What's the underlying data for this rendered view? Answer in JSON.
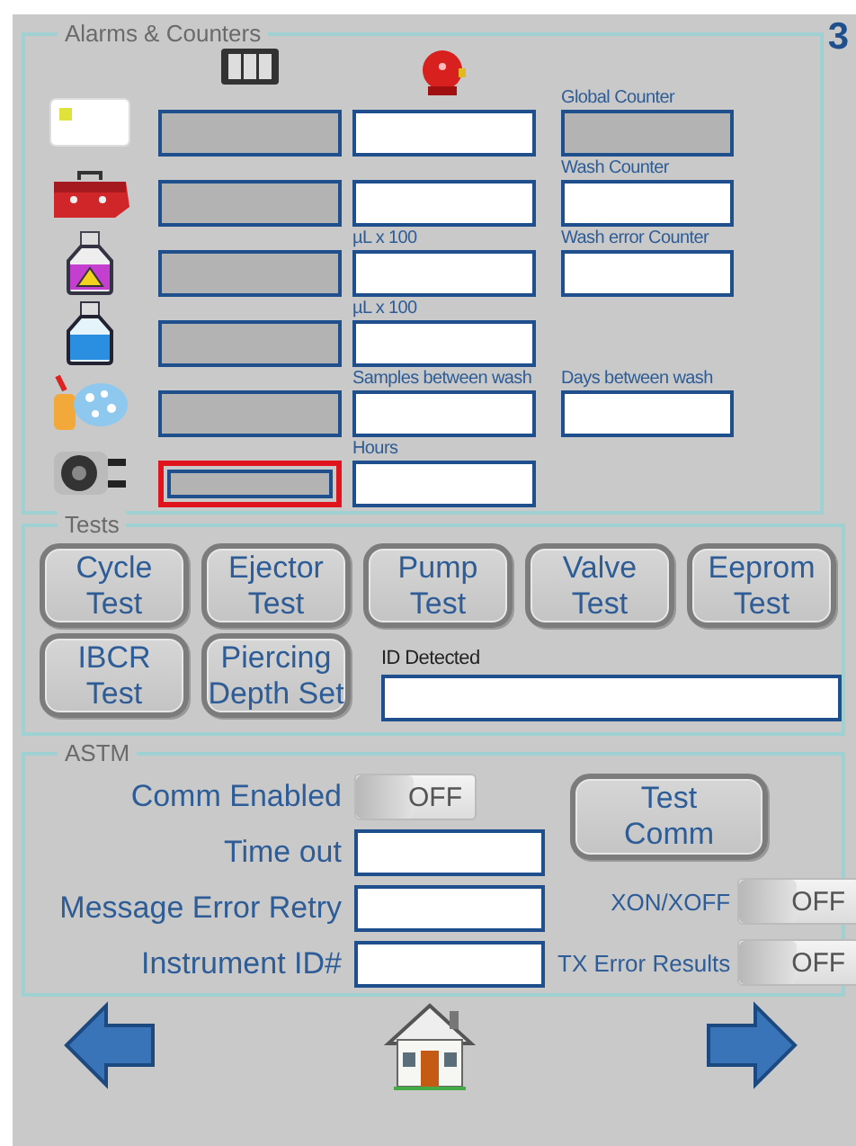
{
  "page_number": "3",
  "alarms": {
    "title": "Alarms & Counters",
    "rows": [
      {
        "kind": "label-card",
        "counter": {
          "disabled": true,
          "selected": false
        },
        "alarm": {
          "disabled": false
        },
        "extra": {
          "label": "Global Counter",
          "disabled": true
        }
      },
      {
        "kind": "toolbox",
        "counter": {
          "disabled": true,
          "selected": false
        },
        "alarm": {
          "disabled": false
        },
        "extra": {
          "label": "Wash Counter",
          "disabled": false
        }
      },
      {
        "kind": "hazard-bottle",
        "counter": {
          "disabled": true,
          "selected": false
        },
        "alarm": {
          "label": "µL x 100",
          "disabled": false
        },
        "extra": {
          "label": "Wash error Counter",
          "disabled": false
        }
      },
      {
        "kind": "bottle",
        "counter": {
          "disabled": true,
          "selected": false
        },
        "alarm": {
          "label": "µL x 100",
          "disabled": false
        }
      },
      {
        "kind": "spray",
        "counter": {
          "disabled": true,
          "selected": false
        },
        "alarm": {
          "label": "Samples between wash",
          "disabled": false
        },
        "extra": {
          "label": "Days between wash",
          "disabled": false
        }
      },
      {
        "kind": "pump",
        "counter": {
          "disabled": true,
          "selected": true
        },
        "alarm": {
          "label": "Hours",
          "disabled": false
        }
      }
    ]
  },
  "tests": {
    "title": "Tests",
    "buttons": [
      {
        "label": [
          "Cycle",
          "Test"
        ]
      },
      {
        "label": [
          "Ejector",
          "Test"
        ]
      },
      {
        "label": [
          "Pump",
          "Test"
        ]
      },
      {
        "label": [
          "Valve",
          "Test"
        ]
      },
      {
        "label": [
          "Eeprom",
          "Test"
        ]
      },
      {
        "label": [
          "IBCR",
          "Test"
        ]
      },
      {
        "label": [
          "Piercing",
          "Depth Set"
        ]
      }
    ],
    "id_field": {
      "label": "ID Detected"
    }
  },
  "astm": {
    "title": "ASTM",
    "comm_enabled": {
      "label": "Comm Enabled",
      "text": "OFF",
      "on": false
    },
    "fields": [
      {
        "label": "Time out"
      },
      {
        "label": "Message Error Retry"
      },
      {
        "label": "Instrument ID#"
      }
    ],
    "test_button": {
      "label": [
        "Test",
        "Comm"
      ]
    },
    "toggles": [
      {
        "label": "XON/XOFF",
        "text": "OFF",
        "on": false
      },
      {
        "label": "TX Error Results",
        "text": "OFF",
        "on": false
      }
    ]
  },
  "nav": [
    {
      "kind": "back"
    },
    {
      "kind": "home"
    },
    {
      "kind": "forward"
    }
  ]
}
